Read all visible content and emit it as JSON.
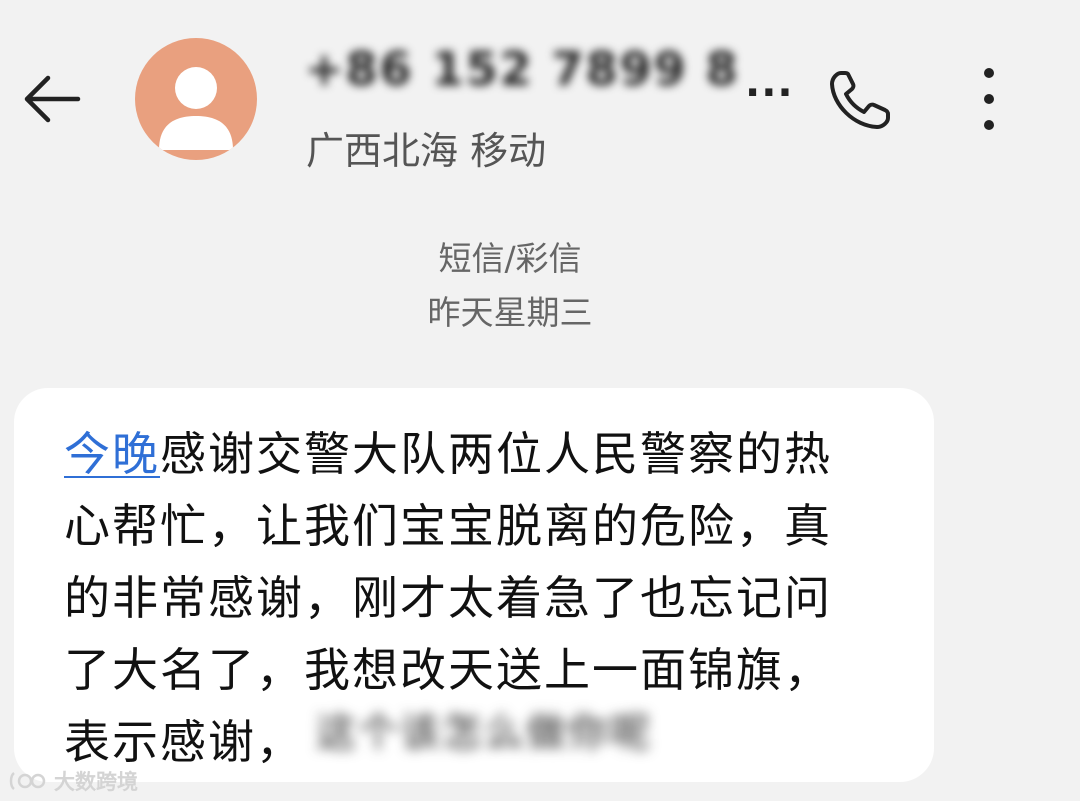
{
  "header": {
    "contact_number": "+86 152 7899 8",
    "number_ellipsis": "...",
    "location": "广西北海 移动"
  },
  "icons": {
    "back": "back-arrow-icon",
    "avatar": "person-icon",
    "call": "phone-icon",
    "more": "more-vertical-icon"
  },
  "conversation": {
    "type_label": "短信/彩信",
    "date_label": "昨天星期三"
  },
  "message": {
    "link_text": "今晚",
    "line1_rest": "感谢交警大队两位人民警察的热",
    "line2": "心帮忙，让我们宝宝脱离的危险，真",
    "line3": "的非常感谢，刚才太着急了也忘记问",
    "line4": "了大名了，我想改天送上一面锦旗，",
    "line5": "表示感谢，",
    "blurred_tail": "这个该怎么做你呢"
  },
  "watermark": {
    "text": "大数跨境"
  },
  "colors": {
    "background": "#f2f2f2",
    "avatar": "#e9a07f",
    "link": "#2f6fd6",
    "bubble": "#ffffff"
  }
}
